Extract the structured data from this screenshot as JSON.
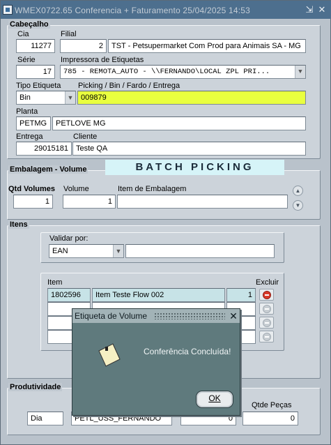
{
  "window": {
    "title": "WMEX0722.65    Conferencia + Faturamento    25/04/2025 14:53",
    "collapse_glyph": "⇲",
    "close_glyph": "✕"
  },
  "cabecalho": {
    "legend": "Cabeçalho",
    "cia_label": "Cia",
    "cia_value": "11277",
    "filial_label": "Filial",
    "filial_code": "2",
    "filial_name": "TST - Petsupermarket Com Prod para Animais SA - MG",
    "serie_label": "Série",
    "serie_value": "17",
    "impressora_label": "Impressora de Etiquetas",
    "impressora_value": "785 - REMOTA_AUTO - \\\\FERNANDO\\LOCAL ZPL PRI...",
    "tipo_etiqueta_label": "Tipo Etiqueta",
    "tipo_etiqueta_value": "Bin",
    "picking_label": "Picking / Bin / Fardo / Entrega",
    "picking_value": "009879",
    "planta_label": "Planta",
    "planta_code": "PETMG",
    "planta_name": "PETLOVE MG",
    "entrega_label": "Entrega",
    "entrega_value": "29015181",
    "cliente_label": "Cliente",
    "cliente_value": "Teste QA"
  },
  "embalagem": {
    "legend": "Embalagem - Volume",
    "banner": "BATCH PICKING",
    "qtd_volumes_label": "Qtd Volumes",
    "qtd_volumes_value": "1",
    "volume_label": "Volume",
    "volume_value": "1",
    "item_embalagem_label": "Item de Embalagem",
    "item_embalagem_value": ""
  },
  "itens": {
    "legend": "Itens",
    "validar_label": "Validar por:",
    "validar_value": "EAN",
    "validar_input": "",
    "item_header": "Item",
    "excluir_header": "Excluir",
    "rows": [
      {
        "code": "1802596",
        "desc": "Item Teste Flow 002",
        "qty": "1"
      },
      {
        "code": "",
        "desc": "",
        "qty": ""
      },
      {
        "code": "",
        "desc": "",
        "qty": ""
      },
      {
        "code": "",
        "desc": "",
        "qty": ""
      }
    ]
  },
  "produtividade": {
    "legend": "Produtividade",
    "qtde_pecas_label": "Qtde Peças",
    "turno_value": "Dia",
    "usuario_value": "PETL_USS_FERNANDO",
    "quantidade_value": "0",
    "qtde_pecas_value": "0"
  },
  "dialog": {
    "title": "Etiqueta de Volume",
    "message": "Conferência Concluída!",
    "ok_label": "OK",
    "close_glyph": "✕"
  }
}
